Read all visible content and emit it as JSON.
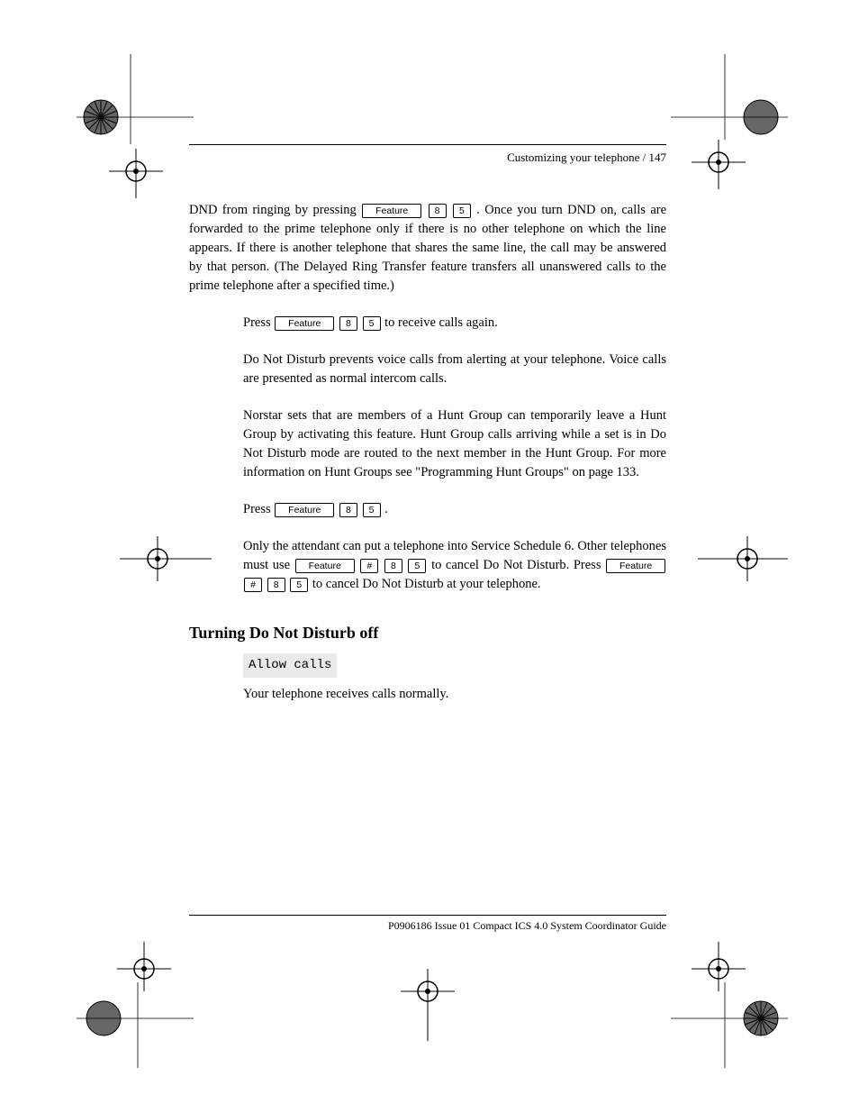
{
  "running_head": "Customizing your telephone / 147",
  "paragraphs": {
    "p1_a": "DND from ringing by pressing ",
    "p1_b": ". Once you turn DND on, calls are forwarded to the prime telephone only if there is no other telephone on which the line appears. If there is another telephone that shares the same line, the call may be answered by that person. (The Delayed Ring Transfer feature transfers all unanswered calls to the prime telephone after a specified time.)",
    "p2_a": "Press ",
    "p2_b": " to receive calls again.",
    "p3": "Do Not Disturb prevents voice calls from alerting at your telephone. Voice calls are presented as normal intercom calls.",
    "p4": "Norstar sets that are members of a Hunt Group can temporarily leave a Hunt Group by activating this feature. Hunt Group calls arriving while a set is in Do Not Disturb mode are routed to the next member in the Hunt Group. For more information on Hunt Groups see \"Programming Hunt Groups\" on page 133.",
    "p5_a": "Press ",
    "p5_b": ".",
    "p6_a": "Only the attendant can put a telephone into Service Schedule 6. Other telephones must use ",
    "p6_b": " to cancel Do Not Disturb. Press ",
    "p6_c": " to cancel Do Not Disturb at your telephone."
  },
  "keys": {
    "featureWord": "Feature",
    "eight": "8",
    "five": "5",
    "pound": "#"
  },
  "section": {
    "title": "Turning Do Not Disturb off",
    "feature_label": "Allow calls",
    "feature_desc": "Your telephone receives calls normally."
  },
  "footer": {
    "line": "P0906186 Issue 01            Compact ICS 4.0 System Coordinator Guide"
  }
}
